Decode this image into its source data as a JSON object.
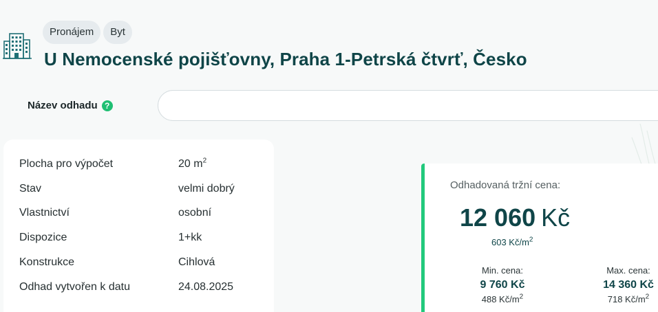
{
  "header": {
    "chips": [
      "Pronájem",
      "Byt"
    ],
    "title": "U Nemocenské pojišťovny, Praha 1-Petrská čtvrť, Česko",
    "icon": "building-icon"
  },
  "estimate_name": {
    "label": "Název odhadu",
    "value": "",
    "help_icon": "question-icon"
  },
  "details": {
    "rows": [
      {
        "label": "Plocha pro výpočet",
        "value": "20 m",
        "sup": "2"
      },
      {
        "label": "Stav",
        "value": "velmi dobrý"
      },
      {
        "label": "Vlastnictví",
        "value": "osobní"
      },
      {
        "label": "Dispozice",
        "value": "1+kk"
      },
      {
        "label": "Konstrukce",
        "value": "Cihlová"
      },
      {
        "label": "Odhad vytvořen k datu",
        "value": "24.08.2025"
      }
    ]
  },
  "price": {
    "caption": "Odhadovaná tržní cena:",
    "amount": "12 060",
    "currency": "Kč",
    "per_m2": "603 Kč/m",
    "per_m2_sup": "2",
    "min": {
      "label": "Min. cena:",
      "value": "9 760 Kč",
      "per_m2": "488 Kč/m",
      "sup": "2"
    },
    "max": {
      "label": "Max. cena:",
      "value": "14 360 Kč",
      "per_m2": "718 Kč/m",
      "sup": "2"
    }
  },
  "colors": {
    "brand_dark": "#0f4548",
    "accent_green": "#22c97c"
  }
}
